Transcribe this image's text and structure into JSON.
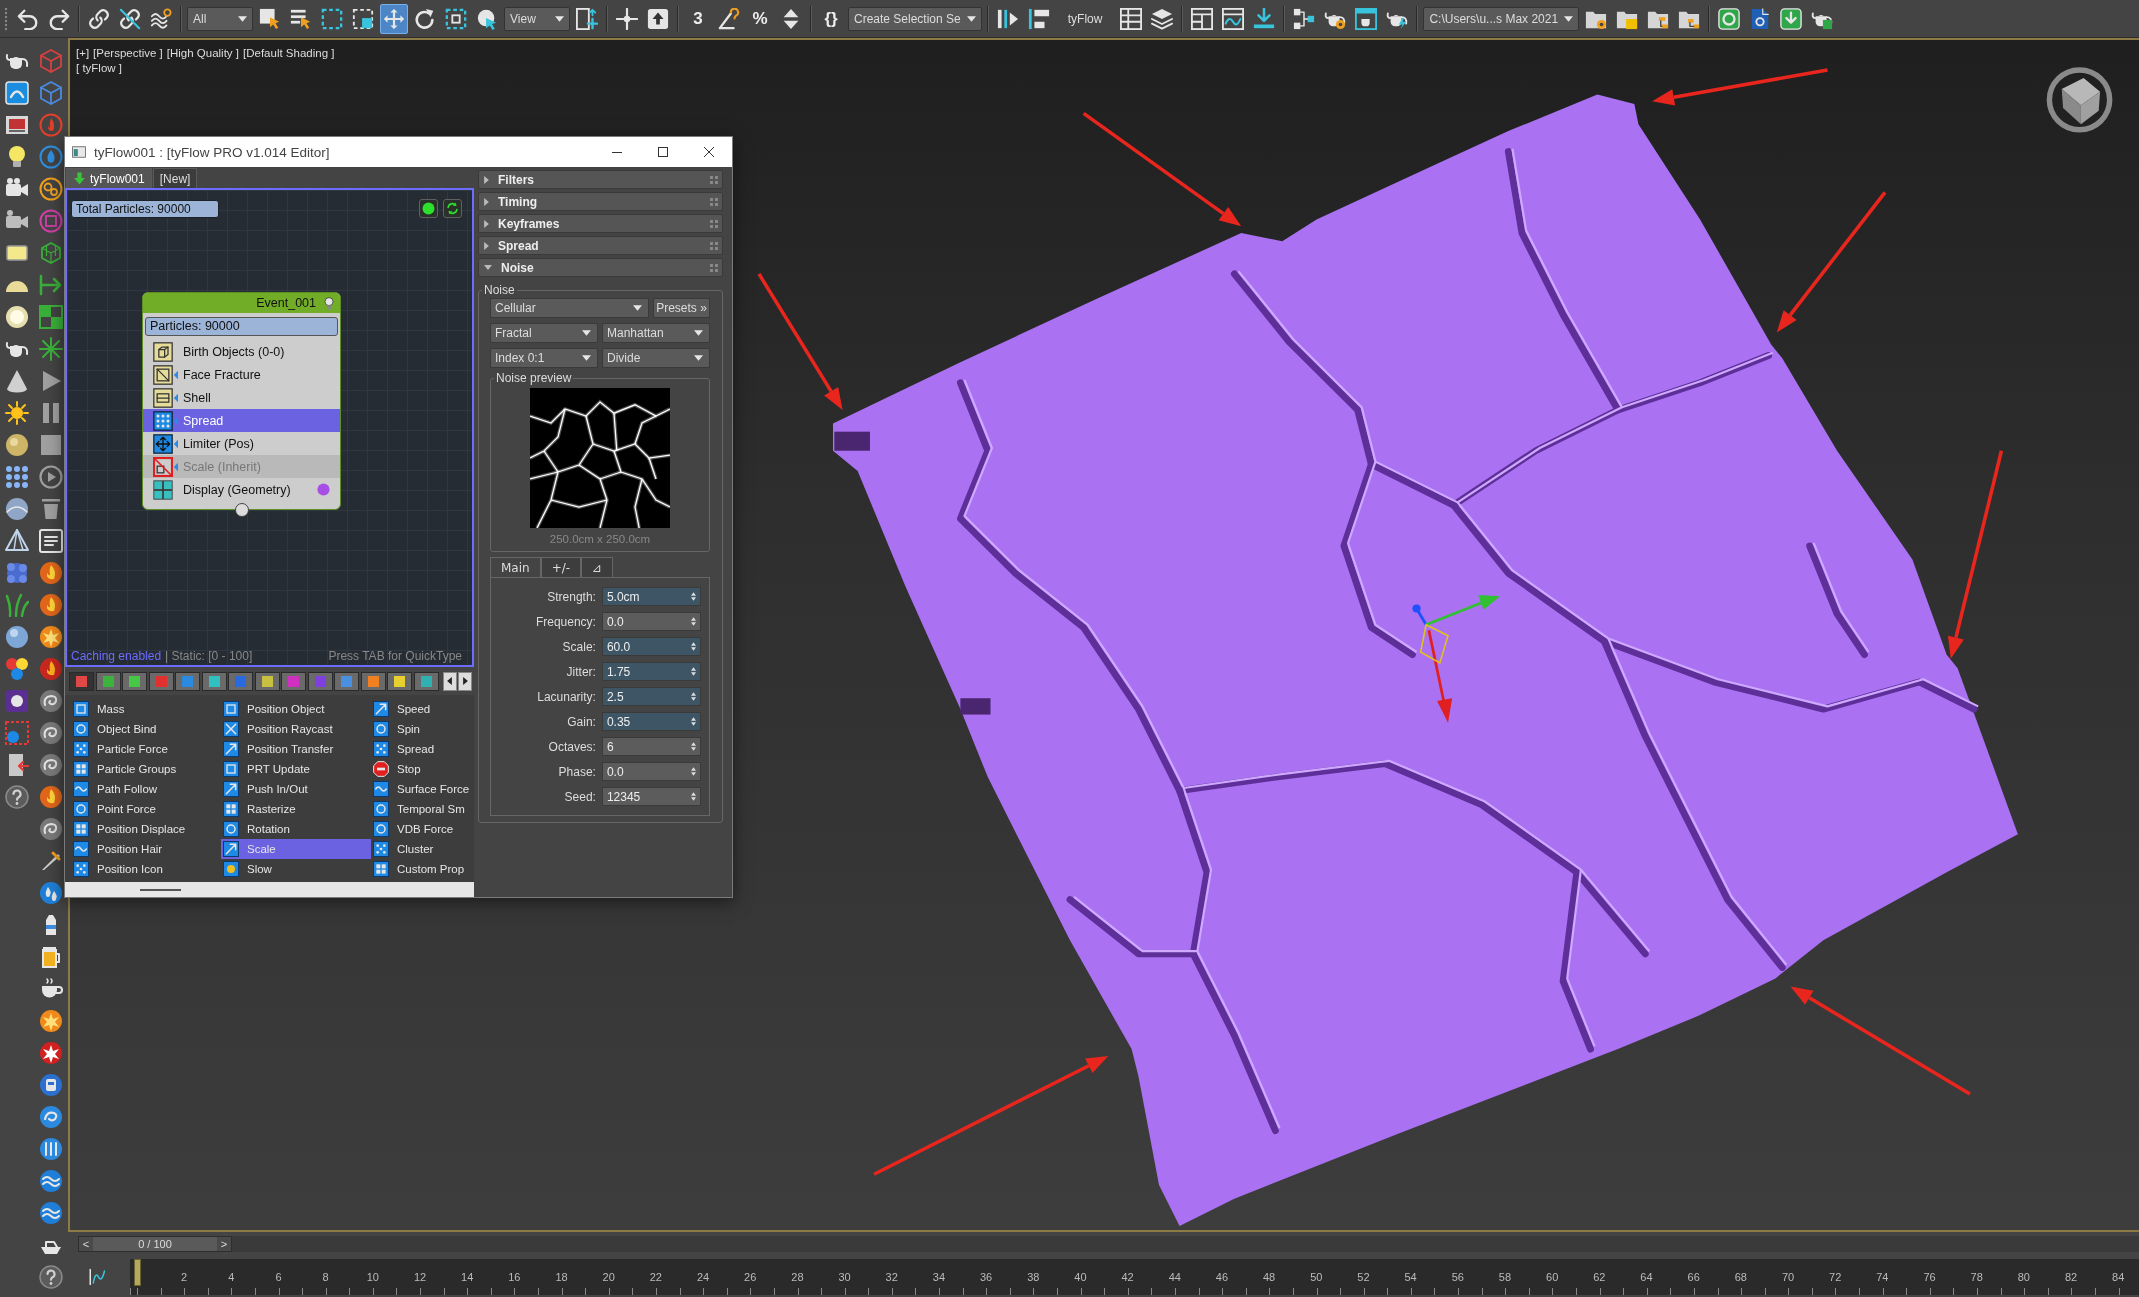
{
  "toolbar": [
    {
      "kind": "button",
      "selected": false
    },
    {
      "kind": "button",
      "selected": false
    },
    {
      "kind": "button",
      "selected": false
    },
    {
      "kind": "button",
      "selected": false
    },
    {
      "kind": "button",
      "selected": false
    },
    {
      "kind": "dropdown",
      "value": "All"
    },
    {
      "kind": "button",
      "selected": false
    },
    {
      "kind": "button",
      "selected": false
    },
    {
      "kind": "button",
      "selected": false
    },
    {
      "kind": "button",
      "selected": false
    },
    {
      "kind": "button",
      "selected": true
    },
    {
      "kind": "button",
      "selected": false
    },
    {
      "kind": "button",
      "selected": false
    },
    {
      "kind": "button",
      "selected": false
    },
    {
      "kind": "dropdown",
      "value": "View"
    },
    {
      "kind": "button",
      "selected": false
    },
    {
      "kind": "button",
      "selected": false
    },
    {
      "kind": "button",
      "selected": false
    },
    {
      "kind": "text_button",
      "label": "3",
      "selected": false
    },
    {
      "kind": "button",
      "selected": false
    },
    {
      "kind": "text_button",
      "label": "%",
      "selected": false
    },
    {
      "kind": "button",
      "selected": false
    },
    {
      "kind": "text_button",
      "label": "{}",
      "selected": false
    },
    {
      "kind": "dropdown",
      "value": "Create Selection Se"
    },
    {
      "kind": "button",
      "selected": false
    },
    {
      "kind": "button",
      "selected": false
    },
    {
      "kind": "label",
      "text": "tyFlow"
    },
    {
      "kind": "button",
      "selected": false
    },
    {
      "kind": "button",
      "selected": false
    },
    {
      "kind": "button",
      "selected": false
    },
    {
      "kind": "button",
      "selected": false
    },
    {
      "kind": "button",
      "selected": false
    },
    {
      "kind": "button",
      "selected": false
    },
    {
      "kind": "button",
      "selected": false
    },
    {
      "kind": "button",
      "selected": false
    },
    {
      "kind": "button",
      "selected": false
    },
    {
      "kind": "dropdown",
      "value": "C:\\Users\\u...s Max 2021"
    },
    {
      "kind": "button",
      "selected": false
    },
    {
      "kind": "button",
      "selected": false
    },
    {
      "kind": "button",
      "selected": false
    },
    {
      "kind": "button",
      "selected": false
    },
    {
      "kind": "button",
      "selected": false
    },
    {
      "kind": "button",
      "selected": false
    },
    {
      "kind": "button",
      "selected": false
    },
    {
      "kind": "button",
      "selected": false
    }
  ],
  "viewport": {
    "labels": [
      "[+]",
      "[Perspective ]",
      "[High Quality ]",
      "[Default Shading ]"
    ],
    "object_label": "[ tyFlow ]"
  },
  "editor": {
    "title": "tyFlow001 : [tyFlow PRO v1.014 Editor]",
    "tabs": [
      {
        "kind": "flow",
        "label": "tyFlow001",
        "selected": true
      },
      {
        "kind": "new",
        "label": "[New]",
        "selected": false
      }
    ],
    "total_particles": "Total Particles: 90000",
    "event": {
      "title": "Event_001",
      "particles": "Particles: 90000",
      "operators": [
        {
          "kind": "birth",
          "label": "Birth Objects (0-0)",
          "selected": false,
          "disabled": false
        },
        {
          "kind": "fracture",
          "label": "Face Fracture",
          "selected": false,
          "disabled": false
        },
        {
          "kind": "shell",
          "label": "Shell",
          "selected": false,
          "disabled": false
        },
        {
          "kind": "spread",
          "label": "Spread",
          "selected": true,
          "disabled": false
        },
        {
          "kind": "limiter",
          "label": "Limiter (Pos)",
          "selected": false,
          "disabled": false
        },
        {
          "kind": "scale",
          "label": "Scale (Inherit)",
          "selected": false,
          "disabled": true
        },
        {
          "kind": "display",
          "label": "Display (Geometry)",
          "selected": false,
          "disabled": false,
          "color": "#a64ee6"
        }
      ]
    },
    "status": {
      "caching": "Caching enabled",
      "static": "| Static: [0 - 100]",
      "hint": "Press TAB for QuickType"
    },
    "category_tabs": [
      {
        "color": "#e04848",
        "selected": true
      },
      {
        "color": "#3cb43c",
        "selected": false
      },
      {
        "color": "#46c846",
        "selected": false
      },
      {
        "color": "#e03030",
        "selected": false
      },
      {
        "color": "#2a8ae0",
        "selected": false
      },
      {
        "color": "#30c0c0",
        "selected": false
      },
      {
        "color": "#2a6ae0",
        "selected": false
      },
      {
        "color": "#c8c040",
        "selected": false
      },
      {
        "color": "#d030c0",
        "selected": false
      },
      {
        "color": "#8040e0",
        "selected": false
      },
      {
        "color": "#4a90e0",
        "selected": false
      },
      {
        "color": "#f08020",
        "selected": false
      },
      {
        "color": "#e8d030",
        "selected": false
      },
      {
        "color": "#30b0b0",
        "selected": false
      }
    ],
    "operator_list": [
      {
        "label": "Mass",
        "selected": false
      },
      {
        "label": "Object Bind",
        "selected": false
      },
      {
        "label": "Particle Force",
        "selected": false
      },
      {
        "label": "Particle Groups",
        "selected": false
      },
      {
        "label": "Path Follow",
        "selected": false
      },
      {
        "label": "Point Force",
        "selected": false
      },
      {
        "label": "Position Displace",
        "selected": false
      },
      {
        "label": "Position Hair",
        "selected": false
      },
      {
        "label": "Position Icon",
        "selected": false
      },
      {
        "label": "Position Object",
        "selected": false
      },
      {
        "label": "Position Raycast",
        "selected": false
      },
      {
        "label": "Position Transfer",
        "selected": false
      },
      {
        "label": "PRT Update",
        "selected": false
      },
      {
        "label": "Push In/Out",
        "selected": false
      },
      {
        "label": "Rasterize",
        "selected": false
      },
      {
        "label": "Rotation",
        "selected": false
      },
      {
        "label": "Scale",
        "selected": true
      },
      {
        "label": "Slow",
        "selected": false
      },
      {
        "label": "Speed",
        "selected": false
      },
      {
        "label": "Spin",
        "selected": false
      },
      {
        "label": "Spread",
        "selected": false
      },
      {
        "label": "Stop",
        "selected": false
      },
      {
        "label": "Surface Force",
        "selected": false
      },
      {
        "label": "Temporal Sm",
        "selected": false
      },
      {
        "label": "VDB Force",
        "selected": false
      },
      {
        "label": "Cluster",
        "selected": false
      },
      {
        "label": "Custom Prop",
        "selected": false
      }
    ],
    "rollouts": [
      {
        "title": "Filters",
        "expanded": false
      },
      {
        "title": "Timing",
        "expanded": false
      },
      {
        "title": "Keyframes",
        "expanded": false
      },
      {
        "title": "Spread",
        "expanded": false
      },
      {
        "title": "Noise",
        "expanded": true,
        "content": {
          "group_label": "Noise",
          "noise_type": "Cellular",
          "presets_button": "Presets »",
          "dropdowns": [
            "Fractal",
            "Manhattan",
            "Index 0:1",
            "Divide"
          ],
          "preview_label": "Noise preview",
          "preview_size": "250.0cm x 250.0cm",
          "tabs": [
            {
              "label": "Main",
              "selected": true
            },
            {
              "label": "+/-",
              "selected": false
            },
            {
              "label": "⊿",
              "selected": false
            }
          ],
          "params": [
            {
              "label": "Strength:",
              "value": "5.0cm",
              "highlighted": true
            },
            {
              "label": "Frequency:",
              "value": "0.0",
              "highlighted": false
            },
            {
              "label": "Scale:",
              "value": "60.0",
              "highlighted": true
            },
            {
              "label": "Jitter:",
              "value": "1.75",
              "highlighted": true
            },
            {
              "label": "Lacunarity:",
              "value": "2.5",
              "highlighted": true
            },
            {
              "label": "Gain:",
              "value": "0.35",
              "highlighted": true
            },
            {
              "label": "Octaves:",
              "value": "6",
              "highlighted": false
            },
            {
              "label": "Phase:",
              "value": "0.0",
              "highlighted": false
            },
            {
              "label": "Seed:",
              "value": "12345",
              "highlighted": false
            }
          ]
        }
      }
    ]
  },
  "timeline": {
    "slider": {
      "prev": "<",
      "frame": "0 / 100",
      "next": ">",
      "level": 0
    },
    "ruler_labels": [
      "2",
      "4",
      "6",
      "8",
      "10",
      "12",
      "14",
      "16",
      "18",
      "20",
      "22",
      "24",
      "26",
      "28",
      "30",
      "32",
      "34",
      "36",
      "38",
      "40",
      "42",
      "44",
      "46",
      "48",
      "50",
      "52",
      "54",
      "56",
      "58",
      "60",
      "62",
      "64",
      "66",
      "68",
      "70",
      "72",
      "74",
      "76",
      "78",
      "80",
      "82",
      "84"
    ]
  }
}
